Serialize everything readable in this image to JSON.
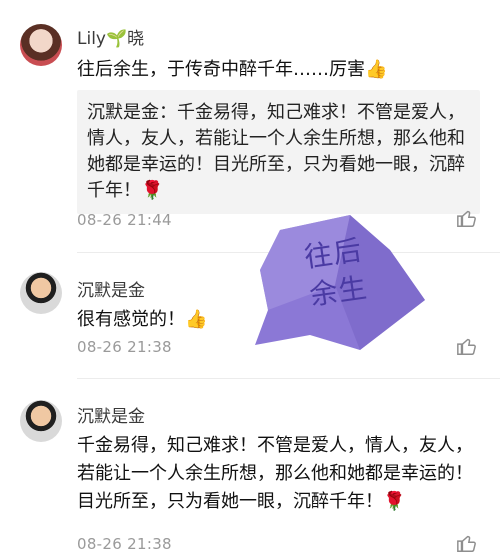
{
  "comments": [
    {
      "name": "Lily🌱晓",
      "text": "往后余生，于传奇中醉千年……厉害👍",
      "quote": "沉默是金：千金易得，知己难求！不管是爱人，情人，友人，若能让一个人余生所想，那么他和她都是幸运的！目光所至，只为看她一眼，沉醉千年！🌹",
      "time": "08-26 21:44"
    },
    {
      "name": "沉默是金",
      "text": "很有感觉的！👍",
      "time": "08-26 21:38"
    },
    {
      "name": "沉默是金",
      "text": "千金易得，知己难求！不管是爱人，情人，友人，若能让一个人余生所想，那么他和她都是幸运的！目光所至，只为看她一眼，沉醉千年！🌹",
      "time": "08-26 21:38"
    }
  ],
  "badge": {
    "text": "往后余生",
    "color": "#8b78d6"
  }
}
